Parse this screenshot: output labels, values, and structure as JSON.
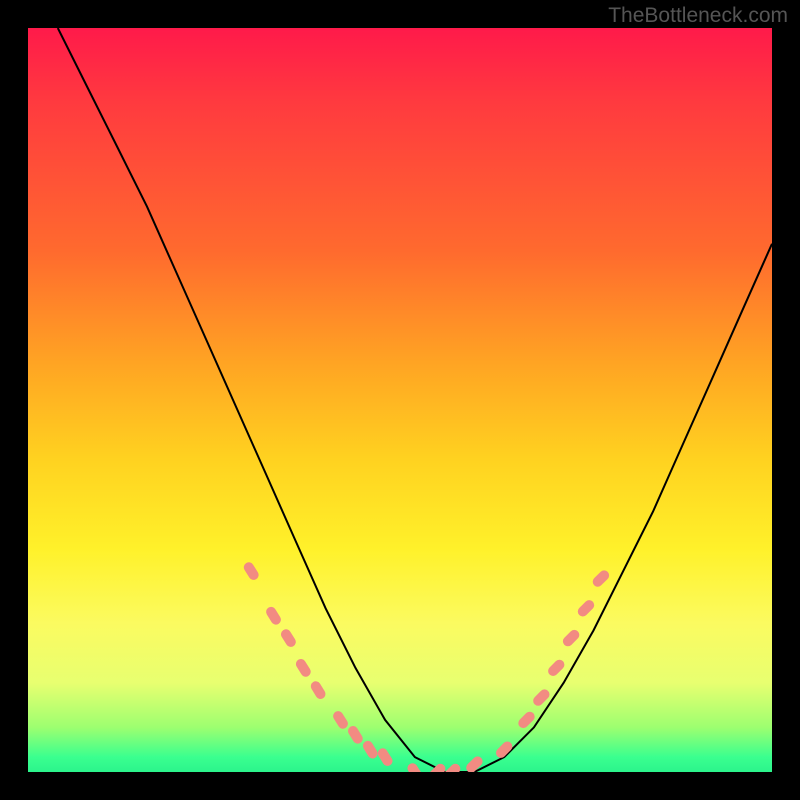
{
  "watermark": "TheBottleneck.com",
  "chart_data": {
    "type": "line",
    "title": "",
    "xlabel": "",
    "ylabel": "",
    "xlim": [
      0,
      100
    ],
    "ylim": [
      0,
      100
    ],
    "series": [
      {
        "name": "bottleneck-curve",
        "x": [
          4,
          8,
          12,
          16,
          20,
          24,
          28,
          32,
          36,
          40,
          44,
          48,
          52,
          56,
          60,
          64,
          68,
          72,
          76,
          80,
          84,
          88,
          92,
          96,
          100
        ],
        "y": [
          100,
          92,
          84,
          76,
          67,
          58,
          49,
          40,
          31,
          22,
          14,
          7,
          2,
          0,
          0,
          2,
          6,
          12,
          19,
          27,
          35,
          44,
          53,
          62,
          71
        ]
      }
    ],
    "markers": {
      "name": "highlight-points",
      "color": "#f28b82",
      "points": [
        {
          "x": 30,
          "y": 27
        },
        {
          "x": 33,
          "y": 21
        },
        {
          "x": 35,
          "y": 18
        },
        {
          "x": 37,
          "y": 14
        },
        {
          "x": 39,
          "y": 11
        },
        {
          "x": 42,
          "y": 7
        },
        {
          "x": 44,
          "y": 5
        },
        {
          "x": 46,
          "y": 3
        },
        {
          "x": 48,
          "y": 2
        },
        {
          "x": 52,
          "y": 0
        },
        {
          "x": 55,
          "y": 0
        },
        {
          "x": 57,
          "y": 0
        },
        {
          "x": 60,
          "y": 1
        },
        {
          "x": 64,
          "y": 3
        },
        {
          "x": 67,
          "y": 7
        },
        {
          "x": 69,
          "y": 10
        },
        {
          "x": 71,
          "y": 14
        },
        {
          "x": 73,
          "y": 18
        },
        {
          "x": 75,
          "y": 22
        },
        {
          "x": 77,
          "y": 26
        }
      ]
    },
    "gradient_stops": [
      {
        "pos": 0.0,
        "color": "#ff1a4a"
      },
      {
        "pos": 0.5,
        "color": "#ffd220"
      },
      {
        "pos": 0.8,
        "color": "#fbfb60"
      },
      {
        "pos": 1.0,
        "color": "#2cf48c"
      }
    ]
  }
}
